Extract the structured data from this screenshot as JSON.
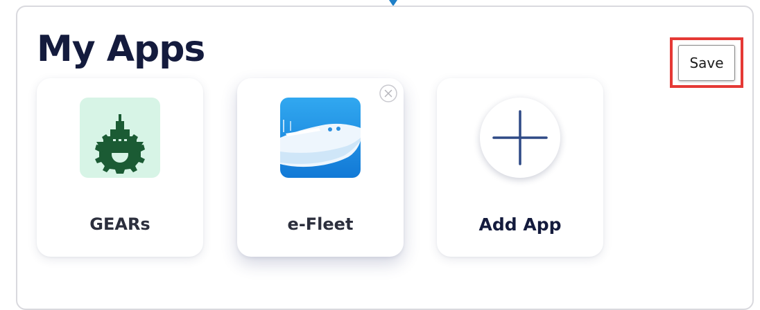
{
  "header": {
    "title": "My Apps",
    "save_label": "Save"
  },
  "apps": [
    {
      "label": "GEARs",
      "icon": "gears-ship-icon"
    },
    {
      "label": "e-Fleet",
      "icon": "e-fleet-ship-icon"
    }
  ],
  "add_app": {
    "label": "Add App",
    "icon": "plus-icon"
  },
  "colors": {
    "title": "#141b3d",
    "highlight": "#e53935",
    "gears_bg": "#d7f4e6",
    "gears_icon": "#1b5b34",
    "efleet_bg": "#1f8fe0",
    "plus": "#2f4a86"
  }
}
